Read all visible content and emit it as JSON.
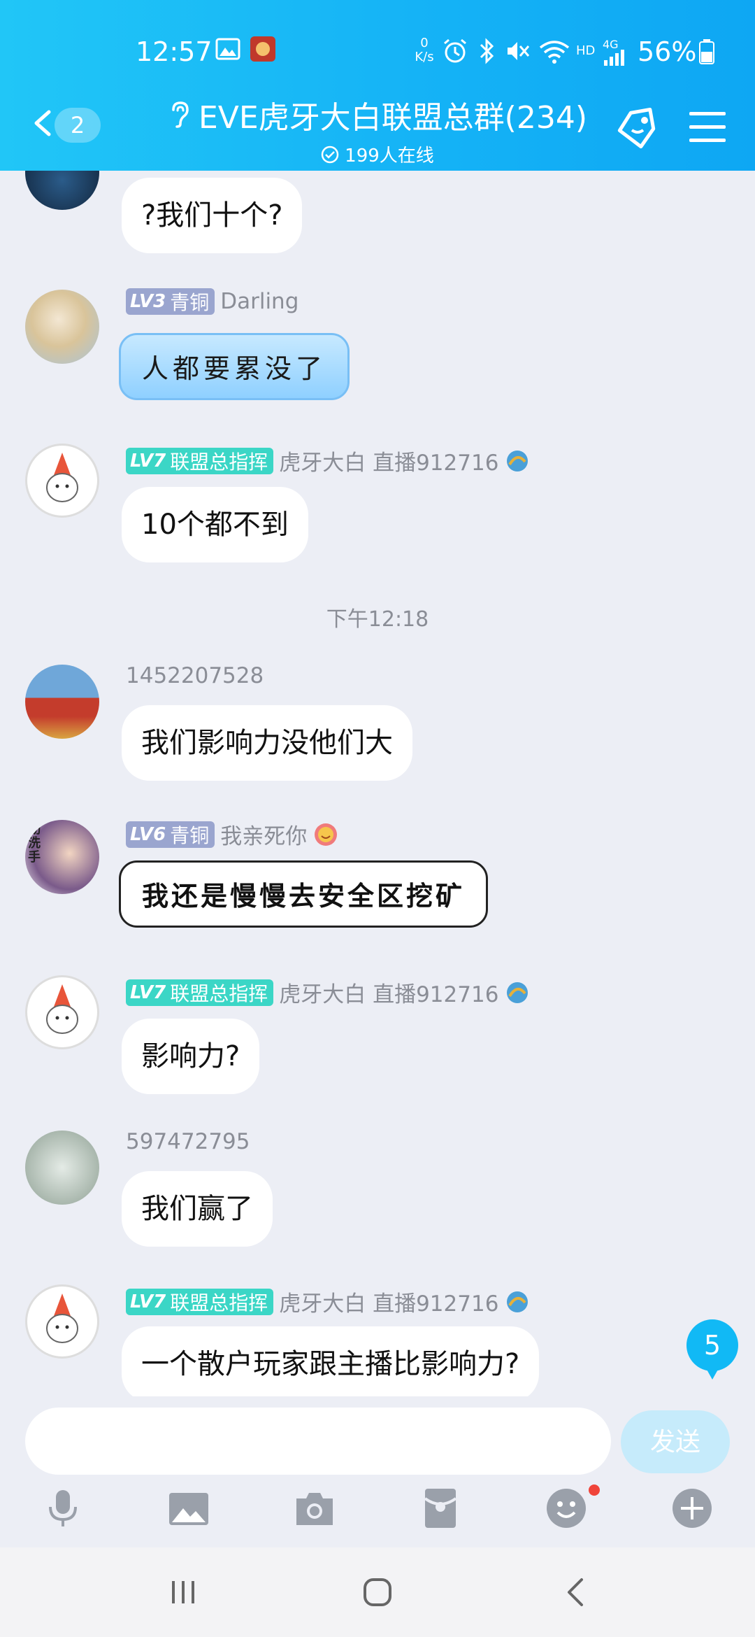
{
  "status_bar": {
    "time": "12:57",
    "net_speed_top": "0",
    "net_speed_bottom": "K/s",
    "network_label": "HD",
    "network_type": "4G",
    "battery": "56%"
  },
  "header": {
    "unread_count": "2",
    "title": "EVE虎牙大白联盟总群(234)",
    "online": "199人在线"
  },
  "messages": [
    {
      "id": "m0",
      "text": "?我们十个?"
    },
    {
      "id": "m1",
      "level": "LV3",
      "rank": "青铜",
      "name": "Darling",
      "text": "人都要累没了"
    },
    {
      "id": "m2",
      "level": "LV7",
      "rank": "联盟总指挥",
      "name": "虎牙大白 直播912716",
      "text": "10个都不到"
    },
    {
      "id": "m3",
      "name": "1452207528",
      "text": "我们影响力没他们大"
    },
    {
      "id": "m4",
      "level": "LV6",
      "rank": "青铜",
      "name": "我亲死你",
      "text": "我还是慢慢去安全区挖矿"
    },
    {
      "id": "m5",
      "level": "LV7",
      "rank": "联盟总指挥",
      "name": "虎牙大白 直播912716",
      "text": "影响力?"
    },
    {
      "id": "m6",
      "name": "597472795",
      "text": "我们赢了"
    },
    {
      "id": "m7",
      "level": "LV7",
      "rank": "联盟总指挥",
      "name": "虎牙大白 直播912716",
      "text": "一个散户玩家跟主播比影响力?"
    }
  ],
  "timestamp": "下午12:18",
  "new_messages_count": "5",
  "input": {
    "placeholder": "",
    "send_label": "发送"
  },
  "avatar_text": "勤洗手",
  "colors": {
    "accent": "#15b3f6",
    "badge_bronze": "#9aa5cf",
    "badge_green": "#3bd6c6"
  }
}
